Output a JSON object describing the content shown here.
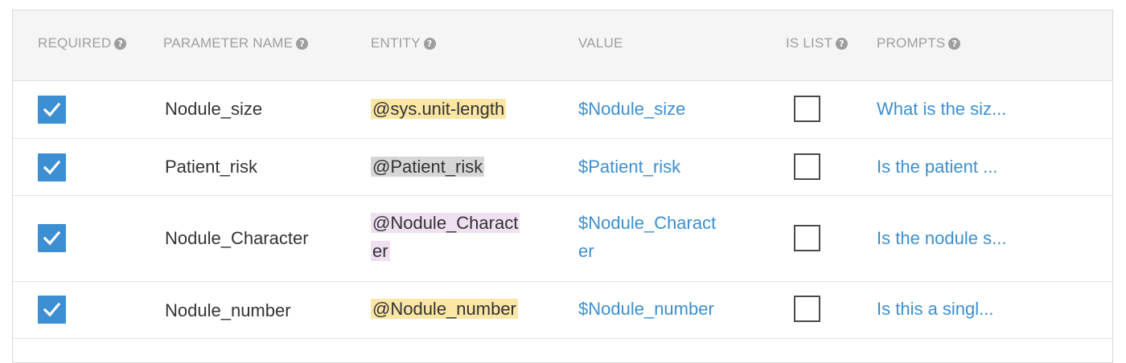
{
  "columns": {
    "required": "REQUIRED",
    "parameter_name": "PARAMETER NAME",
    "entity": "ENTITY",
    "value": "VALUE",
    "is_list": "IS LIST",
    "prompts": "PROMPTS"
  },
  "help_icon_glyph": "?",
  "entity_colors": {
    "sys_unit_length": "#fbe6a6",
    "patient_risk": "#d6d6d6",
    "nodule_character": "#efdff0",
    "nodule_number": "#fbe6a6"
  },
  "accent_checkbox_color": "#3d8fd4",
  "link_color": "#3c8fcf",
  "rows": [
    {
      "required": true,
      "parameter_name": "Nodule_size",
      "entity": "@sys.unit-length",
      "value": "$Nodule_size",
      "is_list": false,
      "prompt": "What is the siz..."
    },
    {
      "required": true,
      "parameter_name": "Patient_risk",
      "entity": "@Patient_risk",
      "value": "$Patient_risk",
      "is_list": false,
      "prompt": "Is the patient ..."
    },
    {
      "required": true,
      "parameter_name": "Nodule_Character",
      "entity_line1": "@Nodule_Charact",
      "entity_line2": "er",
      "value_line1": "$Nodule_Charact",
      "value_line2": "er",
      "is_list": false,
      "prompt": "Is the nodule s..."
    },
    {
      "required": true,
      "parameter_name": "Nodule_number",
      "entity": "@Nodule_number",
      "value": "$Nodule_number",
      "is_list": false,
      "prompt": "Is this a singl..."
    }
  ]
}
